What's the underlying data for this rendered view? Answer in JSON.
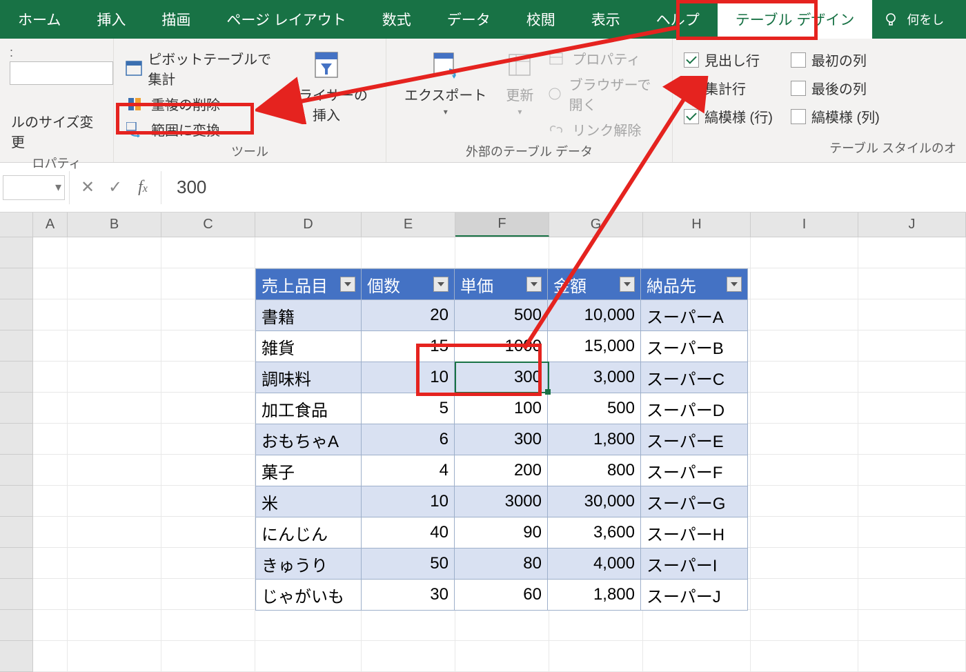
{
  "ribbon": {
    "tabs": [
      "ホーム",
      "挿入",
      "描画",
      "ページ レイアウト",
      "数式",
      "データ",
      "校閲",
      "表示",
      "ヘルプ",
      "テーブル デザイン"
    ],
    "active_tab": "テーブル デザイン",
    "tellme_label": "何をし"
  },
  "group_properties": {
    "resize_label": "ルのサイズ変更",
    "group_label": "ロパティ"
  },
  "group_tools": {
    "pivot": "ピボットテーブルで集計",
    "dedup": "重複の削除",
    "convert": "範囲に変換",
    "slicer_btn": "スライサーの\n挿入",
    "group_label": "ツール"
  },
  "group_external": {
    "export": "エクスポート",
    "refresh": "更新",
    "properties": "プロパティ",
    "open_browser": "ブラウザーで開く",
    "unlink": "リンク解除",
    "group_label": "外部のテーブル データ"
  },
  "group_options": {
    "header_row": "見出し行",
    "total_row": "集計行",
    "banded_rows": "縞模様 (行)",
    "first_col": "最初の列",
    "last_col": "最後の列",
    "banded_cols": "縞模様 (列)",
    "group_label": "テーブル スタイルのオ",
    "checked": {
      "header_row": true,
      "total_row": false,
      "banded_rows": true,
      "first_col": false,
      "last_col": false,
      "banded_cols": false
    }
  },
  "formula_bar": {
    "value": "300"
  },
  "columns": [
    "A",
    "B",
    "C",
    "D",
    "E",
    "F",
    "G",
    "H",
    "I",
    "J"
  ],
  "active_column": "F",
  "table": {
    "headers": [
      "売上品目",
      "個数",
      "単価",
      "金額",
      "納品先"
    ],
    "rows": [
      {
        "item": "書籍",
        "qty": "20",
        "price": "500",
        "amount": "10,000",
        "dest": "スーパーA"
      },
      {
        "item": "雑貨",
        "qty": "15",
        "price": "1000",
        "amount": "15,000",
        "dest": "スーパーB"
      },
      {
        "item": "調味料",
        "qty": "10",
        "price": "300",
        "amount": "3,000",
        "dest": "スーパーC"
      },
      {
        "item": "加工食品",
        "qty": "5",
        "price": "100",
        "amount": "500",
        "dest": "スーパーD"
      },
      {
        "item": "おもちゃA",
        "qty": "6",
        "price": "300",
        "amount": "1,800",
        "dest": "スーパーE"
      },
      {
        "item": "菓子",
        "qty": "4",
        "price": "200",
        "amount": "800",
        "dest": "スーパーF"
      },
      {
        "item": "米",
        "qty": "10",
        "price": "3000",
        "amount": "30,000",
        "dest": "スーパーG"
      },
      {
        "item": "にんじん",
        "qty": "40",
        "price": "90",
        "amount": "3,600",
        "dest": "スーパーH"
      },
      {
        "item": "きゅうり",
        "qty": "50",
        "price": "80",
        "amount": "4,000",
        "dest": "スーパーI"
      },
      {
        "item": "じゃがいも",
        "qty": "30",
        "price": "60",
        "amount": "1,800",
        "dest": "スーパーJ"
      }
    ]
  },
  "annotations": {
    "highlighted_tab": "テーブル デザイン",
    "highlighted_command": "範囲に変換",
    "highlighted_cell": "F (調味料 row, 300)"
  }
}
